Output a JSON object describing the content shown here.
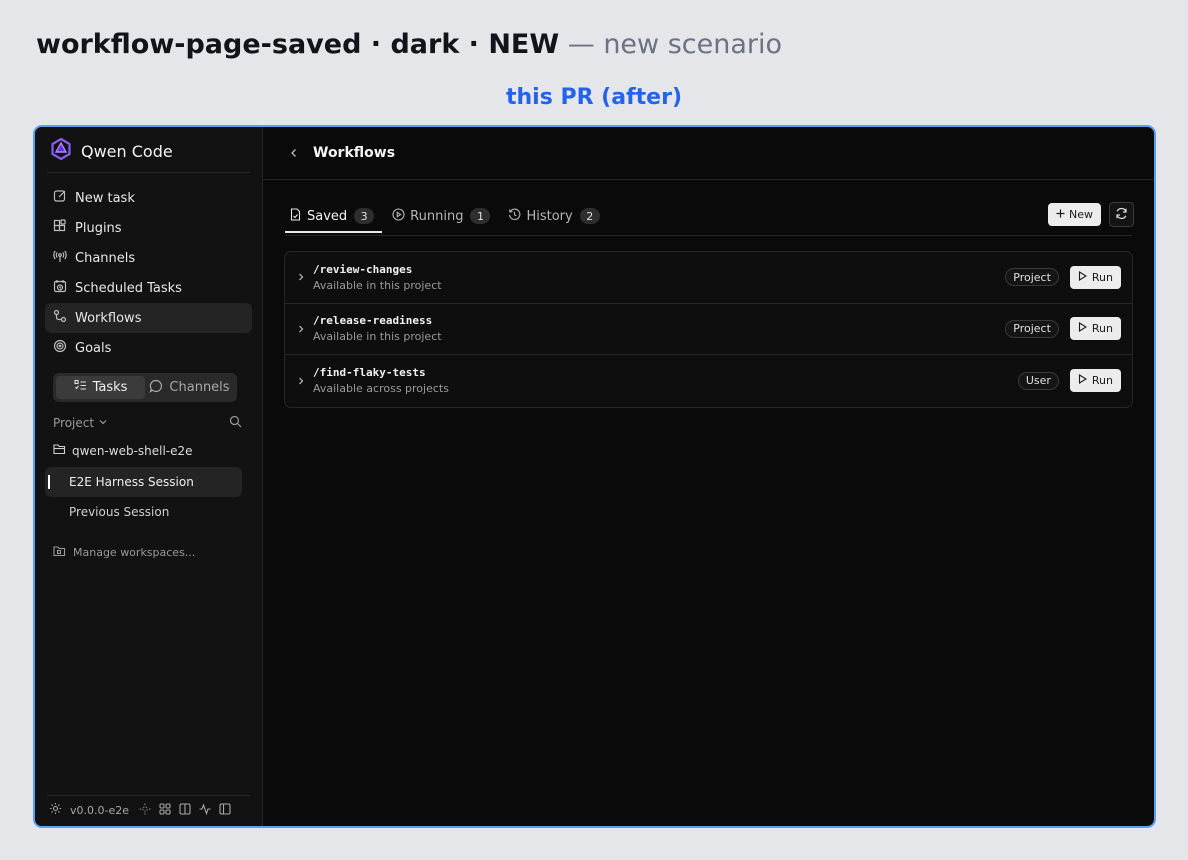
{
  "heading": {
    "scenario": "workflow-page-saved · dark · NEW",
    "suffix": " — new scenario"
  },
  "variant_label": "this PR (after)",
  "app": {
    "name": "Qwen Code",
    "accent": "#7c3aed"
  },
  "sidebar": {
    "nav": [
      {
        "label": "New task",
        "icon": "edit-icon"
      },
      {
        "label": "Plugins",
        "icon": "plugin-icon"
      },
      {
        "label": "Channels",
        "icon": "broadcast-icon"
      },
      {
        "label": "Scheduled Tasks",
        "icon": "calendar-clock-icon"
      },
      {
        "label": "Workflows",
        "icon": "workflow-icon",
        "active": true
      },
      {
        "label": "Goals",
        "icon": "target-icon"
      }
    ],
    "segment": {
      "tasks": "Tasks",
      "channels": "Channels",
      "active": "tasks"
    },
    "project_label": "Project",
    "workspace": "qwen-web-shell-e2e",
    "sessions": [
      {
        "label": "E2E Harness Session",
        "active": true
      },
      {
        "label": "Previous Session",
        "active": false
      }
    ],
    "manage_workspaces": "Manage workspaces...",
    "version": "v0.0.0-e2e"
  },
  "main": {
    "title": "Workflows",
    "tabs": [
      {
        "label": "Saved",
        "count": "3",
        "active": true
      },
      {
        "label": "Running",
        "count": "1",
        "active": false
      },
      {
        "label": "History",
        "count": "2",
        "active": false
      }
    ],
    "new_button": "New",
    "workflows": [
      {
        "name": "/review-changes",
        "desc": "Available in this project",
        "scope": "Project",
        "run": "Run"
      },
      {
        "name": "/release-readiness",
        "desc": "Available in this project",
        "scope": "Project",
        "run": "Run"
      },
      {
        "name": "/find-flaky-tests",
        "desc": "Available across projects",
        "scope": "User",
        "run": "Run"
      }
    ]
  }
}
